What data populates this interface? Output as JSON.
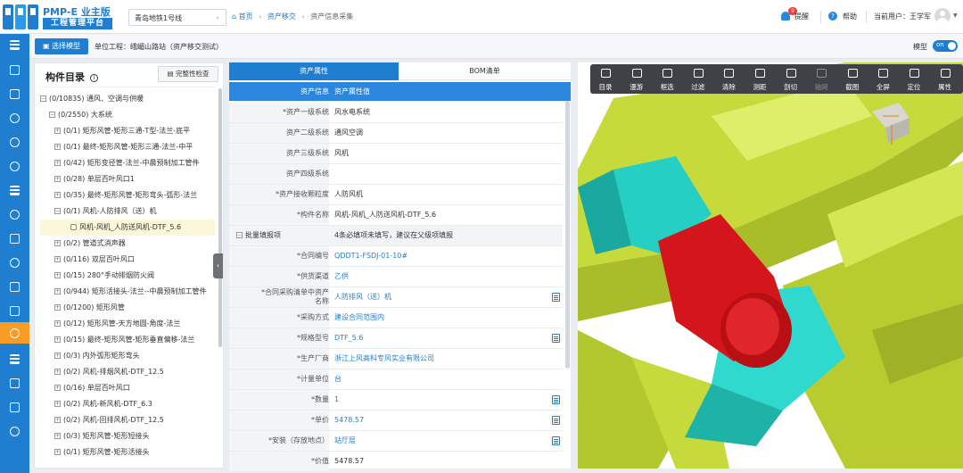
{
  "app": {
    "logo_main": "PMP-E",
    "logo_edition": "业主版",
    "logo_sub": "工程管理平台"
  },
  "header": {
    "line_select": "青岛地铁1号线",
    "breadcrumb": [
      "首页",
      "资产移交",
      "资产信息采集"
    ],
    "reminder_label": "提醒",
    "reminder_count": "9",
    "help_label": "帮助",
    "current_user": "当前用户：王学军"
  },
  "subheader": {
    "select_model_label": "选择模型",
    "unit_project": "单位工程：峨嵋山路站（资产移交测试）",
    "model_label": "模型",
    "model_toggle": "on"
  },
  "tree": {
    "title": "构件目录",
    "check_button": "完整性检查",
    "nodes": [
      {
        "text": "(0/10835) 通风、空调与供暖",
        "toggle": "−"
      },
      {
        "text": "(0/2550) 大系统",
        "toggle": "−"
      },
      {
        "text": "(0/1) 矩形风管-矩形三通-T型-法兰-底平",
        "toggle": "+"
      },
      {
        "text": "(0/1) 最终-矩形风管-矩形三通-法兰-中平",
        "toggle": "+"
      },
      {
        "text": "(0/42) 矩形变径管-法兰-中晨预制加工管件",
        "toggle": "+"
      },
      {
        "text": "(0/28) 单层百叶风口1",
        "toggle": "+"
      },
      {
        "text": "(0/35) 最终-矩形风管-矩形弯头-弧形-法兰",
        "toggle": "+"
      },
      {
        "text": "(0/1) 风机-人防排风（送）机",
        "toggle": "−"
      },
      {
        "text": "风机-风机_人防送风机-DTF_5.6",
        "toggle": ""
      },
      {
        "text": "(0/2) 管道式消声器",
        "toggle": "+"
      },
      {
        "text": "(0/116) 双层百叶风口",
        "toggle": "+"
      },
      {
        "text": "(0/15) 280°手动排烟防火阀",
        "toggle": "+"
      },
      {
        "text": "(0/944) 矩形活接头-法兰--中晨预制加工管件",
        "toggle": "+"
      },
      {
        "text": "(0/1200) 矩形风管",
        "toggle": "+"
      },
      {
        "text": "(0/12) 矩形风管-天方地圆-角度-法兰",
        "toggle": "+"
      },
      {
        "text": "(0/15) 最终-矩形风管-矩形垂直偏移-法兰",
        "toggle": "+"
      },
      {
        "text": "(0/3) 内外弧形矩形弯头",
        "toggle": "+"
      },
      {
        "text": "(0/2) 风机-排烟风机-DTF_12.5",
        "toggle": "+"
      },
      {
        "text": "(0/16) 单层百叶风口",
        "toggle": "+"
      },
      {
        "text": "(0/2) 风机-新风机-DTF_6.3",
        "toggle": "+"
      },
      {
        "text": "(0/2) 风机-回排风机-DTF_12.5",
        "toggle": "+"
      },
      {
        "text": "(0/3) 矩形风管-矩形短接头",
        "toggle": "+"
      },
      {
        "text": "(0/1) 矩形风管-矩形活接头",
        "toggle": "+"
      }
    ]
  },
  "panel": {
    "tab_active": "资产属性",
    "tab_other": "BOM清单",
    "col_key": "资产信息",
    "col_value": "资产属性值",
    "rows": [
      {
        "key": "*资产一级系统",
        "value": "风水电系统"
      },
      {
        "key": "资产二级系统",
        "value": "通风空调"
      },
      {
        "key": "资产三级系统",
        "value": "风机"
      },
      {
        "key": "资产四级系统",
        "value": ""
      },
      {
        "key": "*资产接收颗粒度",
        "value": "人防风机"
      },
      {
        "key": "*构件名称",
        "value": "风机-风机_人防送风机-DTF_5.6"
      }
    ],
    "batch_label": "批量填报项",
    "batch_hint": "4条必填项未填写，建议在父级项填报",
    "batch_rows": [
      {
        "key": "*合同编号",
        "value": "QDDT1-FSDJ-01-10#"
      },
      {
        "key": "*供货渠道",
        "value": "乙供"
      },
      {
        "key": "*合同采购清单中资产",
        "key2": "名称",
        "value": "人防排风（送）机"
      },
      {
        "key": "*采购方式",
        "value": "建设合同范围内"
      },
      {
        "key": "*规格型号",
        "value": "DTF_5.6"
      },
      {
        "key": "*生产厂商",
        "value": "浙江上风高科专风实业有限公司"
      },
      {
        "key": "*计量单位",
        "value": "台"
      },
      {
        "key": "*数量",
        "value": "1"
      },
      {
        "key": "*单价",
        "value": "5478.57"
      },
      {
        "key": "*安装（存放地点）",
        "value": "站厅层"
      },
      {
        "key": "*价值",
        "value": "5478.57"
      }
    ]
  },
  "viewer": {
    "tools": [
      "目录",
      "漫游",
      "框选",
      "过滤",
      "清除",
      "测距",
      "剖切",
      "轴网",
      "截图",
      "全屏",
      "定位",
      "属性"
    ]
  },
  "colors": {
    "primary": "#1f7ed0",
    "active_nav": "#f79c24",
    "duct_green": "#c8dd3a",
    "fan_red": "#d8141a",
    "cyan": "#27d1c6"
  }
}
